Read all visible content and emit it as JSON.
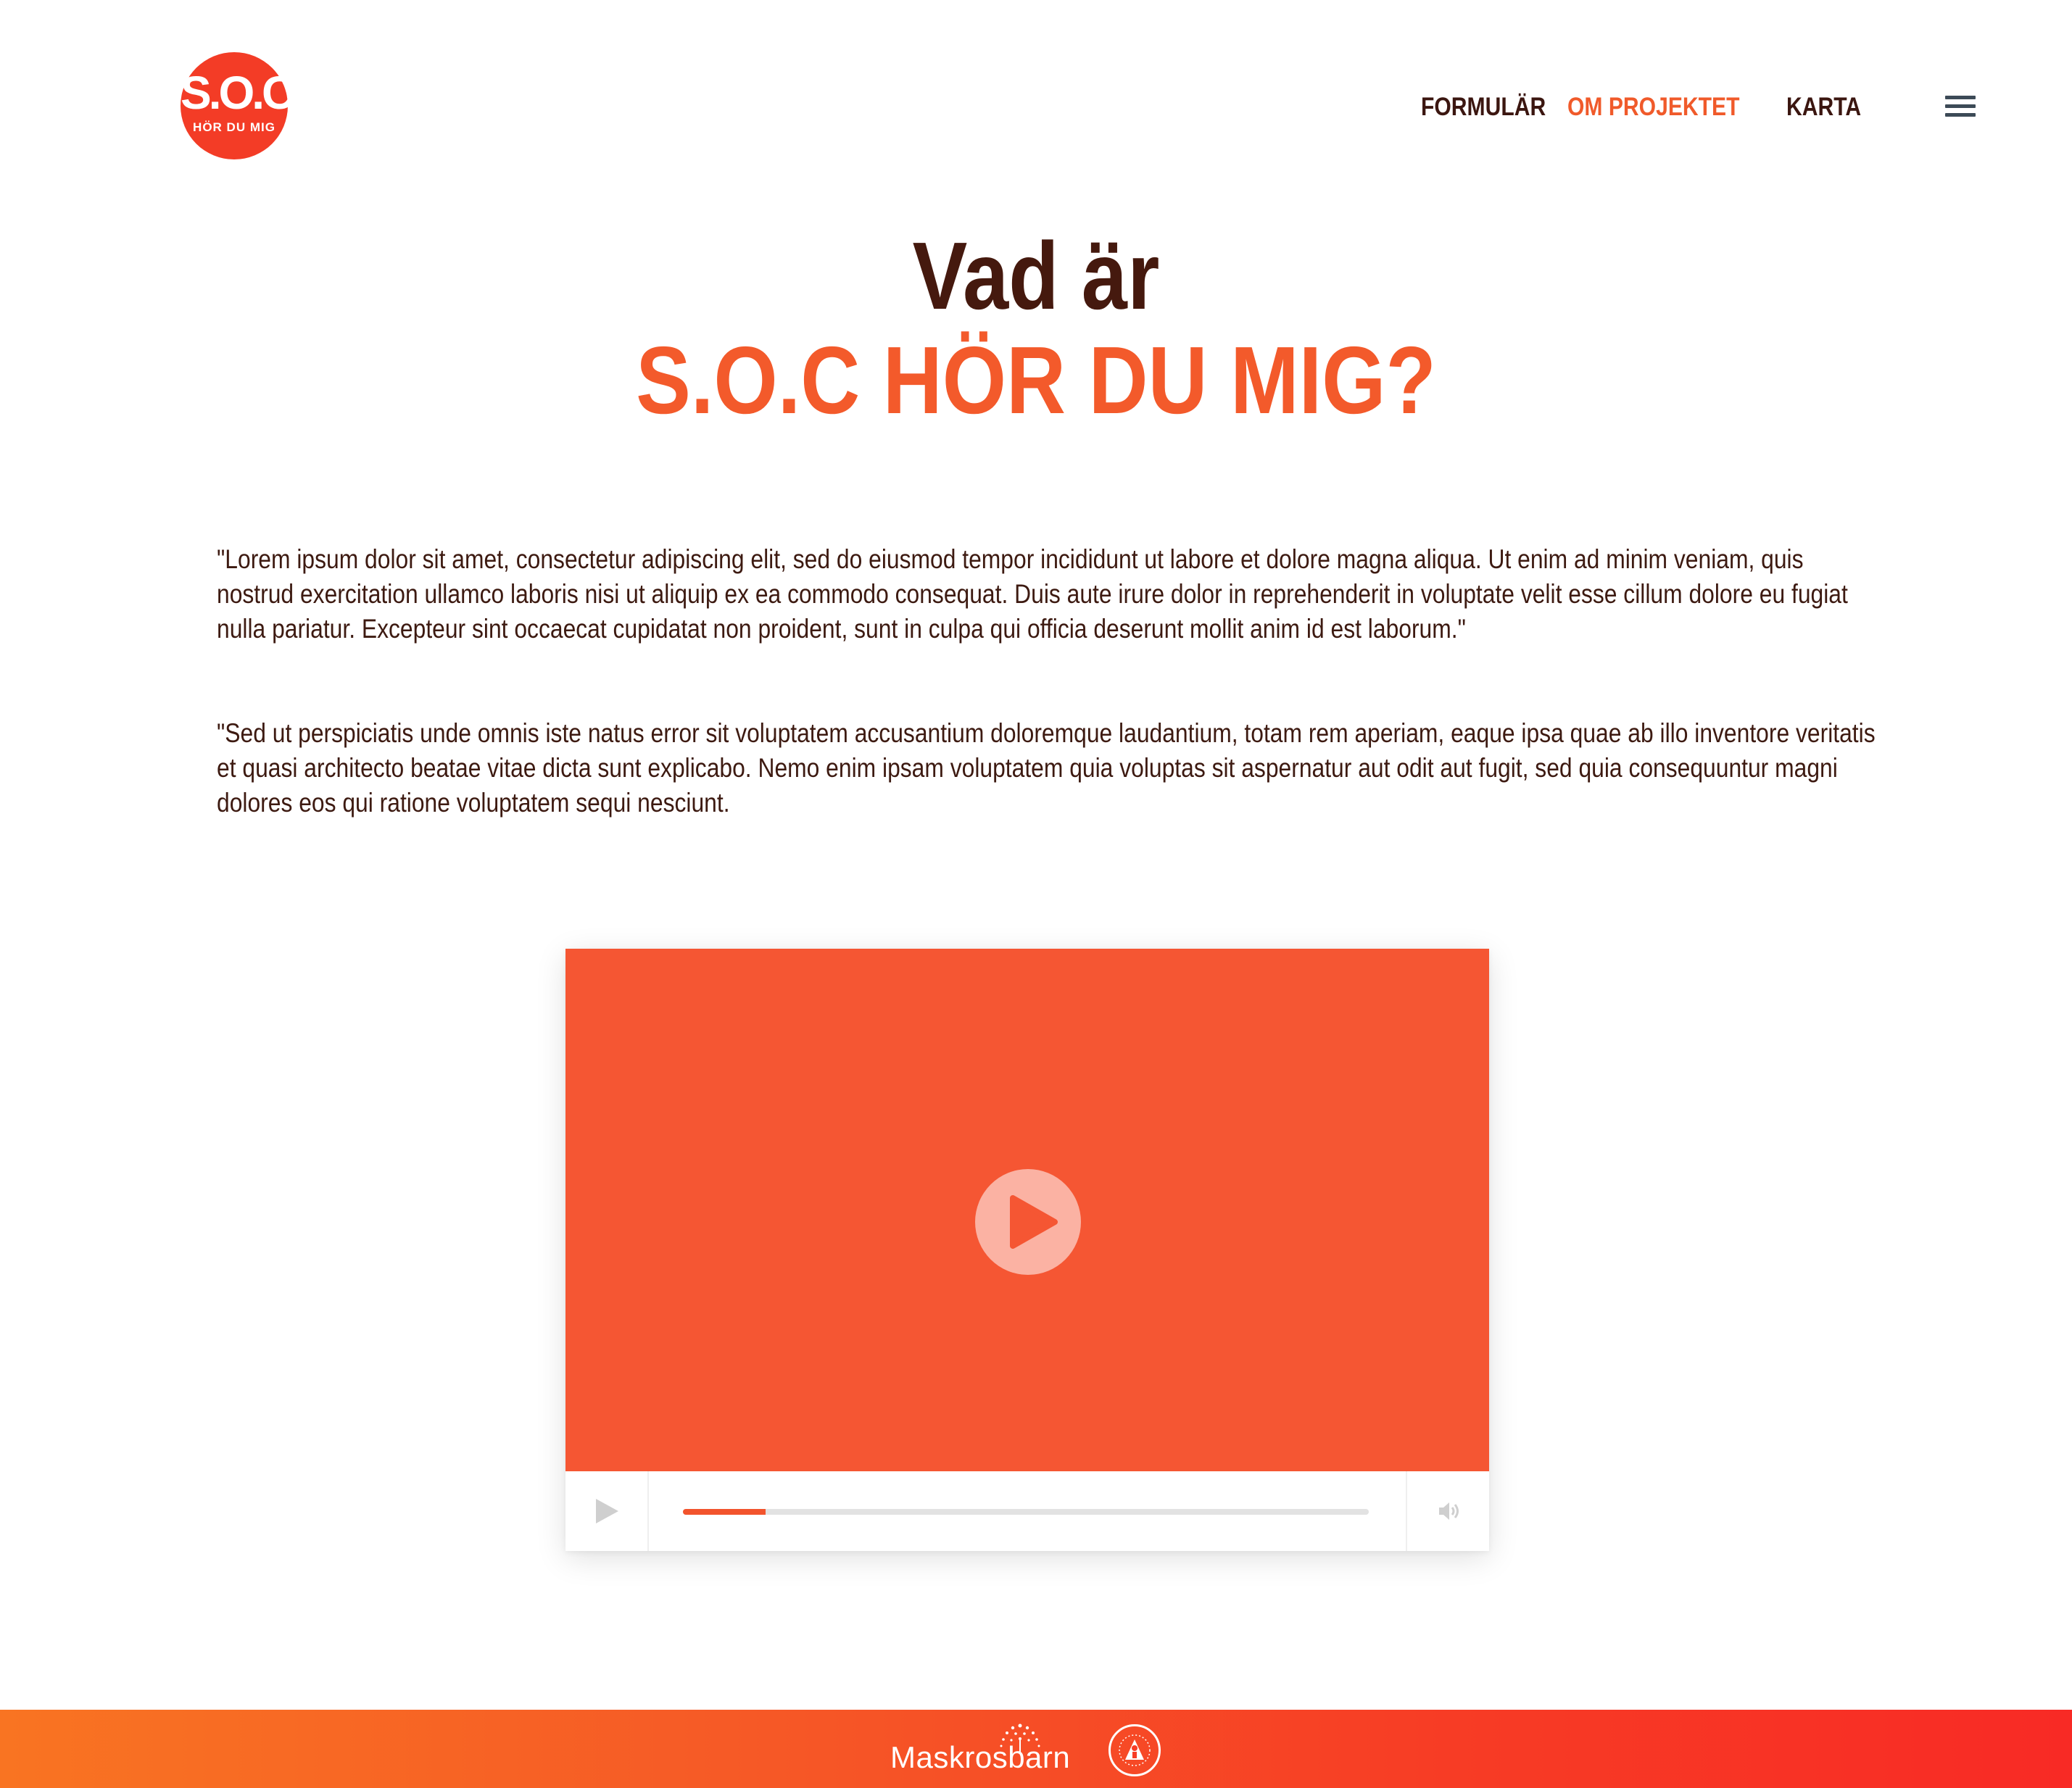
{
  "header": {
    "logo": {
      "line1": "S.O.C.",
      "line2": "HÖR DU MIG"
    },
    "nav": [
      {
        "label": "FORMULÄR",
        "active": false
      },
      {
        "label": "OM PROJEKTET",
        "active": true
      },
      {
        "label": "KARTA",
        "active": false
      }
    ],
    "menu_icon": "hamburger-menu-icon"
  },
  "hero": {
    "title_line1": "Vad är",
    "title_line2": "S.O.C HÖR DU MIG?"
  },
  "content": {
    "paragraphs": [
      "\"Lorem ipsum dolor sit amet, consectetur adipiscing elit, sed do eiusmod tempor incididunt ut labore et dolore magna aliqua. Ut enim ad minim veniam, quis nostrud exercitation ullamco laboris nisi ut aliquip ex ea commodo consequat. Duis aute irure dolor in reprehenderit in voluptate velit esse cillum dolore eu fugiat nulla pariatur. Excepteur sint occaecat cupidatat non proident, sunt in culpa qui officia deserunt mollit anim id est laborum.\"",
      "\"Sed ut perspiciatis unde omnis iste natus error sit voluptatem accusantium doloremque laudantium, totam rem aperiam, eaque ipsa quae ab illo inventore veritatis et quasi architecto beatae vitae dicta sunt explicabo. Nemo enim ipsam voluptatem quia voluptas sit aspernatur aut odit aut fugit, sed quia consequuntur magni dolores eos qui ratione voluptatem sequi nesciunt."
    ]
  },
  "video": {
    "progress_fraction": 0.12,
    "icons": [
      "play-icon",
      "volume-icon"
    ]
  },
  "footer": {
    "brand": "Maskrosbarn"
  },
  "colors": {
    "accent": "#f35a2b",
    "text_dark": "#45190e",
    "video_bg": "#f55633",
    "logo_bg": "#f33c26"
  }
}
